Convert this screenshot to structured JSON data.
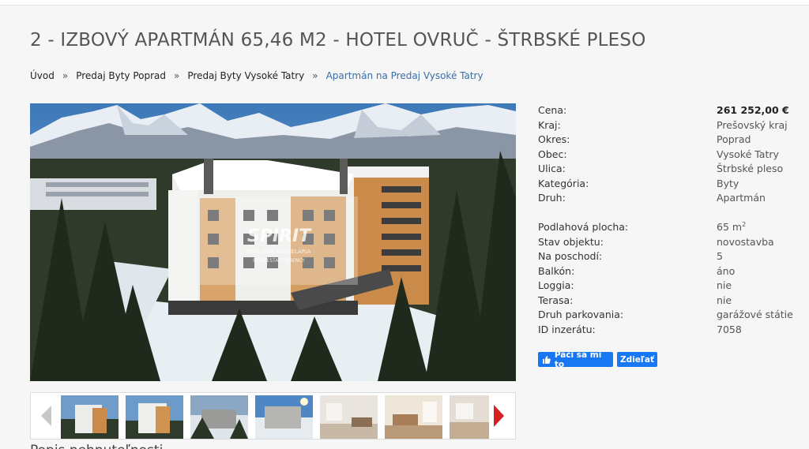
{
  "page": {
    "title": "2 - IZBOVÝ APARTMÁN 65,46 M2 - HOTEL OVRUČ - ŠTRBSKÉ PLESO"
  },
  "breadcrumb": {
    "items": [
      "Úvod",
      "Predaj Byty Poprad",
      "Predaj Byty Vysoké Tatry"
    ],
    "separator": "»",
    "current": "Apartmán na Predaj Vysoké Tatry"
  },
  "gallery": {
    "watermark_brand": "SPIRIT",
    "watermark_line1": "REALITNÁ KANCELÁRIA",
    "watermark_line2": "REAL ESTATE AGENCY",
    "thumbnail_count": 7
  },
  "details": {
    "cena": {
      "label": "Cena:",
      "value": "261 252,00 €"
    },
    "kraj": {
      "label": "Kraj:",
      "value": "Prešovský kraj"
    },
    "okres": {
      "label": "Okres:",
      "value": "Poprad"
    },
    "obec": {
      "label": "Obec:",
      "value": "Vysoké Tatry"
    },
    "ulica": {
      "label": "Ulica:",
      "value": "Štrbské pleso"
    },
    "kategoria": {
      "label": "Kategória:",
      "value": "Byty"
    },
    "druh": {
      "label": "Druh:",
      "value": "Apartmán"
    },
    "plocha": {
      "label": "Podlahová plocha:",
      "value": "65 m",
      "unit_sup": "2"
    },
    "stav": {
      "label": "Stav objektu:",
      "value": "novostavba"
    },
    "poschodie": {
      "label": "Na poschodí:",
      "value": "5"
    },
    "balkon": {
      "label": "Balkón:",
      "value": "áno"
    },
    "loggia": {
      "label": "Loggia:",
      "value": "nie"
    },
    "terasa": {
      "label": "Terasa:",
      "value": "nie"
    },
    "parkovanie": {
      "label": "Druh parkovania:",
      "value": "garážové státie"
    },
    "id": {
      "label": "ID inzerátu:",
      "value": "7058"
    }
  },
  "social": {
    "like_label": "Páči sa mi to",
    "share_label": "Zdieľať",
    "color": "#1877f2"
  },
  "colors": {
    "breadcrumb_current": "#3a6fa6",
    "next_arrow": "#d42020"
  },
  "section_heading_cut": "Popis nehnuteľnosti"
}
